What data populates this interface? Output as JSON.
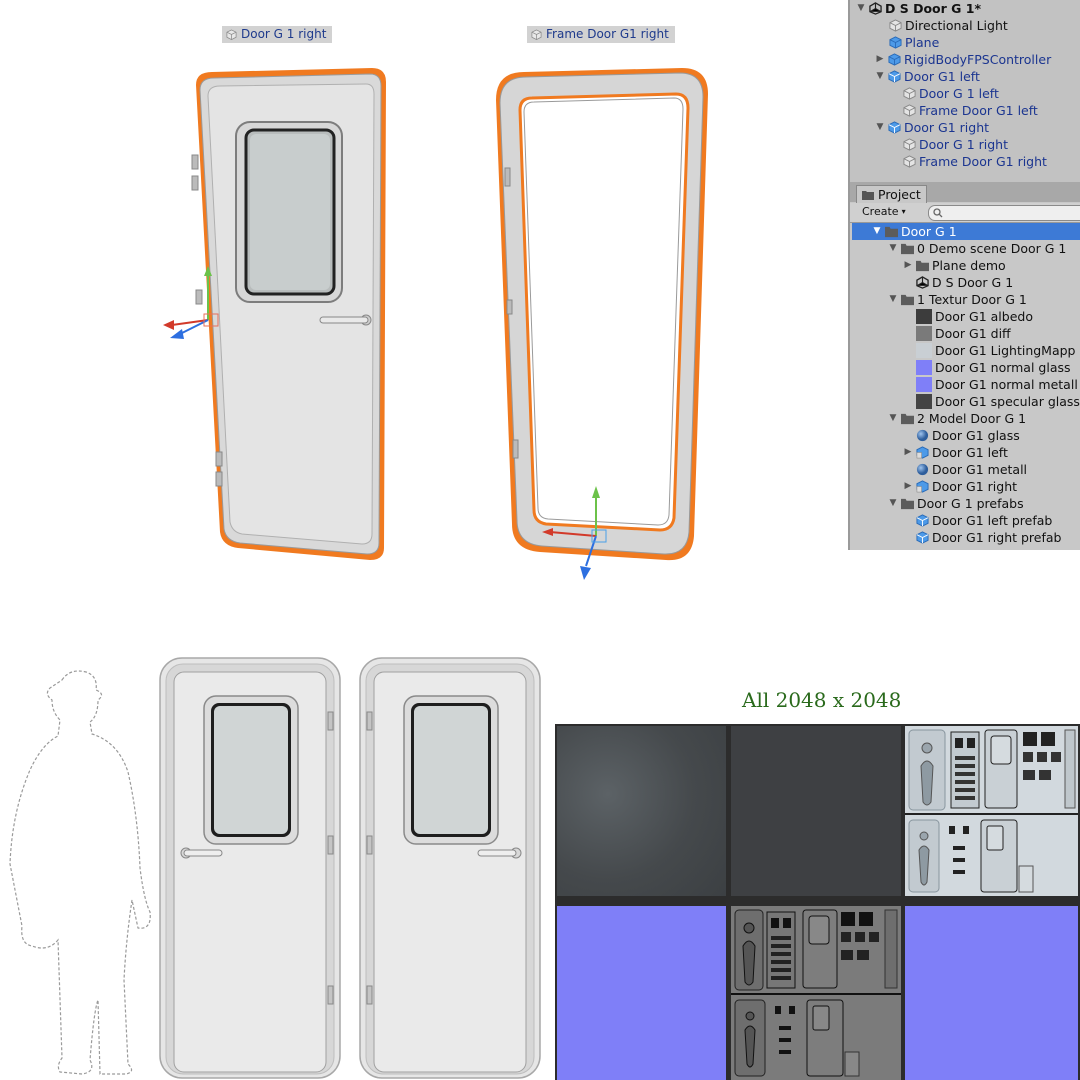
{
  "scene": {
    "door_label": "Door G 1 right",
    "frame_label": "Frame Door G1 right"
  },
  "hierarchy": {
    "scene_name": "D S Door G 1*",
    "items": [
      {
        "label": "Directional Light",
        "icon": "gameobject-icon"
      },
      {
        "label": "Plane",
        "icon": "cube-icon"
      },
      {
        "label": "RigidBodyFPSController",
        "icon": "cube-icon"
      },
      {
        "label": "Door G1 left",
        "icon": "prefab-icon"
      },
      {
        "label": "Door G 1 left",
        "icon": "gameobject-icon"
      },
      {
        "label": "Frame Door G1 left",
        "icon": "gameobject-icon"
      },
      {
        "label": "Door G1 right",
        "icon": "prefab-icon"
      },
      {
        "label": "Door G 1 right",
        "icon": "gameobject-icon"
      },
      {
        "label": "Frame Door G1 right",
        "icon": "gameobject-icon"
      }
    ]
  },
  "project": {
    "tab_label": "Project",
    "create_label": "Create",
    "search_placeholder": "",
    "items": [
      {
        "label": "Door G 1",
        "icon": "folder-icon"
      },
      {
        "label": "0 Demo scene Door G 1",
        "icon": "folder-icon"
      },
      {
        "label": "Plane demo",
        "icon": "folder-icon"
      },
      {
        "label": "D S Door G 1",
        "icon": "unity-scene-icon"
      },
      {
        "label": "1 Textur Door G 1",
        "icon": "folder-icon"
      },
      {
        "label": "Door G1 albedo",
        "icon": "texture-dark-icon"
      },
      {
        "label": "Door G1 diff",
        "icon": "texture-gray-icon"
      },
      {
        "label": "Door G1 LightingMapp",
        "icon": "texture-light-icon"
      },
      {
        "label": "Door G1 normal glass",
        "icon": "texture-normal-icon"
      },
      {
        "label": "Door G1 normal metall",
        "icon": "texture-normal-icon"
      },
      {
        "label": "Door G1 specular glass",
        "icon": "texture-dark-icon"
      },
      {
        "label": "2 Model Door G 1",
        "icon": "folder-icon"
      },
      {
        "label": "Door G1 glass",
        "icon": "material-icon"
      },
      {
        "label": "Door G1 left",
        "icon": "model-icon"
      },
      {
        "label": "Door G1 metall",
        "icon": "material-icon"
      },
      {
        "label": "Door G1 right",
        "icon": "model-icon"
      },
      {
        "label": "Door G 1 prefabs",
        "icon": "folder-icon"
      },
      {
        "label": "Door G1 left prefab",
        "icon": "prefab-icon"
      },
      {
        "label": "Door G1 right prefab",
        "icon": "prefab-icon"
      }
    ]
  },
  "textures": {
    "title": "All 2048 x 2048"
  },
  "colors": {
    "selection": "#3d7ad6",
    "outline": "#f07a20",
    "normal_map": "#7f7ff8",
    "panel_bg": "#c2c2c2"
  }
}
